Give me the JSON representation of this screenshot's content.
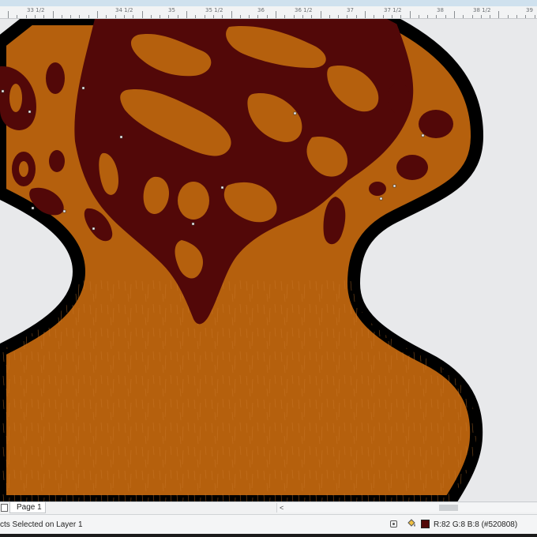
{
  "ruler": {
    "labels": [
      "33 1/2",
      "34 1/2",
      "35",
      "35 1/2",
      "36",
      "36 1/2",
      "37",
      "37 1/2",
      "38",
      "38 1/2",
      "39"
    ]
  },
  "page": {
    "tab_label": "Page 1"
  },
  "status": {
    "selection_text": "cts Selected on Layer 1",
    "color_readout": "R:82 G:8 B:8 (#520808)"
  },
  "colors": {
    "base_fill": "#b5600d",
    "pattern_fill": "#520808",
    "outline": "#000000",
    "desktop": "#e8e9eb"
  },
  "icons": {
    "page": "page-icon",
    "scroll_left": "chevron-left-icon",
    "snap": "snap-target-icon",
    "fill": "fill-bucket-icon"
  }
}
